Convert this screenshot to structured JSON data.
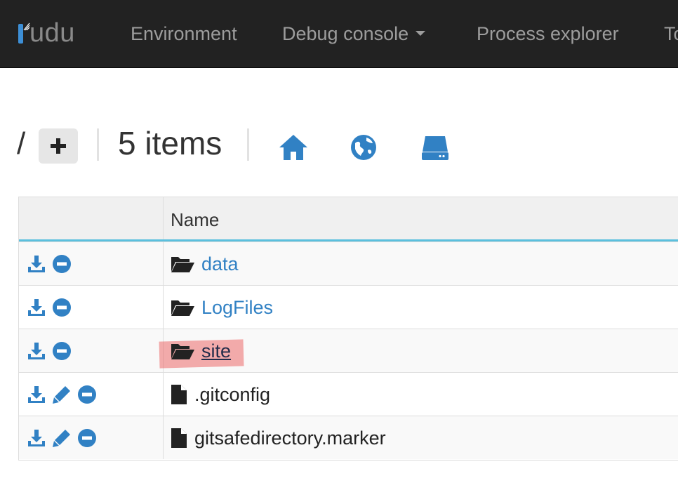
{
  "brand": {
    "name": "udu"
  },
  "nav": {
    "environment": "Environment",
    "debug_console": "Debug console",
    "process_explorer": "Process explorer",
    "tools_partial": "To"
  },
  "toolbar": {
    "path": "/",
    "add_label": "+",
    "items_count": "5 items",
    "icons": [
      "home-icon",
      "globe-icon",
      "drive-icon"
    ]
  },
  "table": {
    "header": {
      "actions": "",
      "name": "Name"
    },
    "rows": [
      {
        "name": "data",
        "type": "folder",
        "actions": [
          "download",
          "delete"
        ]
      },
      {
        "name": "LogFiles",
        "type": "folder",
        "actions": [
          "download",
          "delete"
        ]
      },
      {
        "name": "site",
        "type": "folder",
        "actions": [
          "download",
          "delete"
        ],
        "highlighted": true
      },
      {
        "name": ".gitconfig",
        "type": "file",
        "actions": [
          "download",
          "edit",
          "delete"
        ]
      },
      {
        "name": "gitsafedirectory.marker",
        "type": "file",
        "actions": [
          "download",
          "edit",
          "delete"
        ]
      }
    ]
  },
  "colors": {
    "navbar_bg": "#222222",
    "nav_text": "#9d9d9d",
    "accent": "#3181c4",
    "header_border": "#5bc0de",
    "highlight": "#ec5c5c"
  }
}
